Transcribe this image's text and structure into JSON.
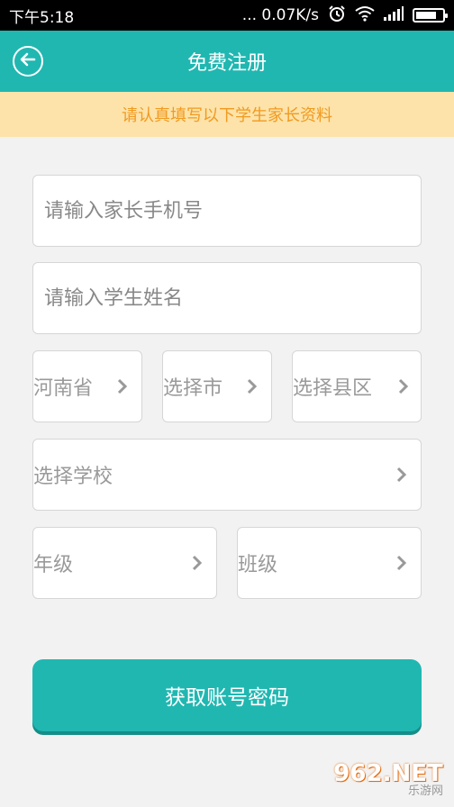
{
  "status_bar": {
    "time": "下午5:18",
    "network_speed": "... 0.07K/s",
    "battery_level": 0.8
  },
  "header": {
    "title": "免费注册",
    "back_icon": "back-arrow-circle-icon"
  },
  "notice": {
    "text": "请认真填写以下学生家长资料"
  },
  "form": {
    "parent_phone": {
      "placeholder": "请输入家长手机号",
      "value": ""
    },
    "student_name": {
      "placeholder": "请输入学生姓名",
      "value": ""
    },
    "province": {
      "label": "河南省"
    },
    "city": {
      "label": "选择市"
    },
    "county": {
      "label": "选择县区"
    },
    "school": {
      "label": "选择学校"
    },
    "grade": {
      "label": "年级"
    },
    "class": {
      "label": "班级"
    },
    "submit_label": "获取账号密码"
  },
  "watermark": {
    "main": "962.NET",
    "sub": "乐游网"
  },
  "colors": {
    "primary": "#20b7b1",
    "notice_bg": "#fde3a9",
    "notice_text": "#f19a20",
    "background": "#f2f2f2"
  }
}
